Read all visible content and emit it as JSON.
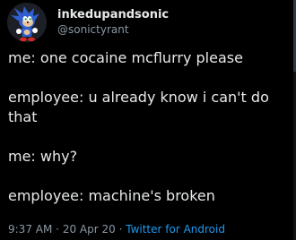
{
  "user": {
    "display_name": "inkedupandsonic",
    "handle": "@sonictyrant"
  },
  "tweet": {
    "lines": [
      "me: one cocaine mcflurry please",
      "employee: u already know i can't do that",
      "me: why?",
      "employee: machine's broken"
    ],
    "time": "9:37 AM",
    "date": "20 Apr 20",
    "source": "Twitter for Android",
    "separator": "·"
  },
  "colors": {
    "background": "#000000",
    "text": "#e7e9ea",
    "secondary": "#8b98a5",
    "link": "#1d9bf0"
  },
  "icons": {
    "avatar": "sonic-avatar"
  }
}
